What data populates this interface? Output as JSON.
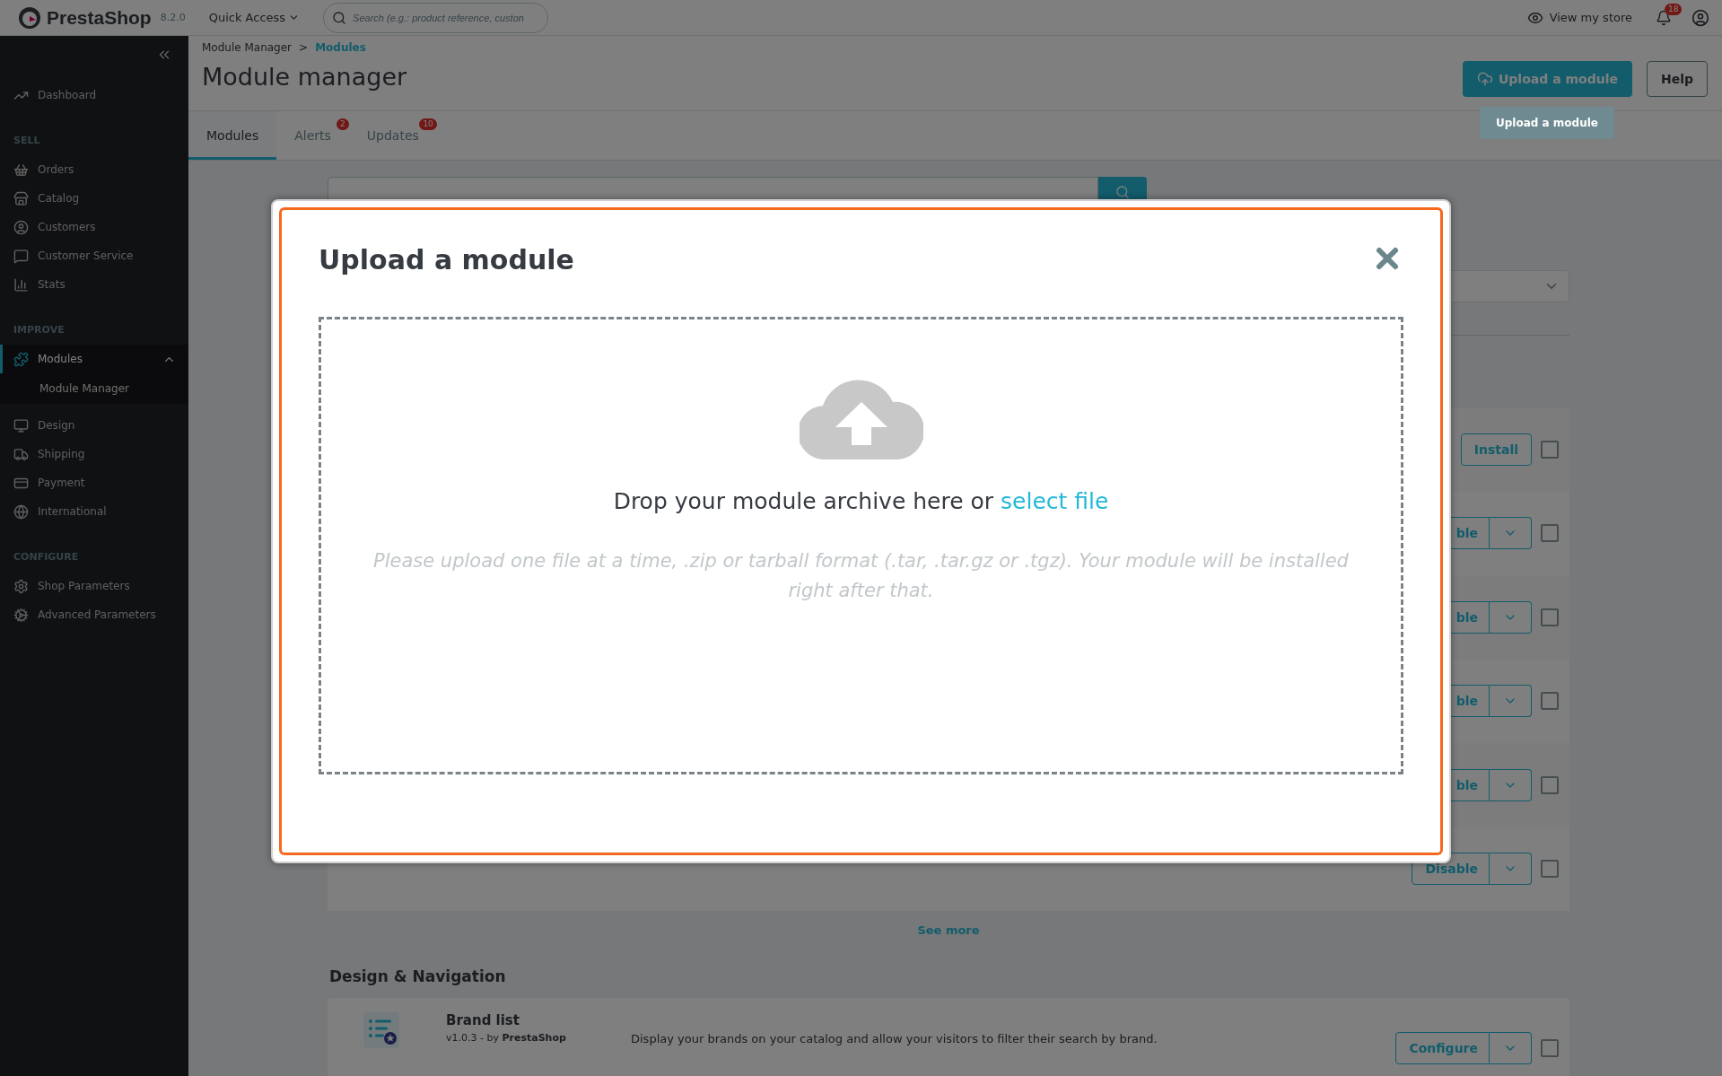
{
  "topbar": {
    "logo": "PrestaShop",
    "version": "8.2.0",
    "quick_access": "Quick Access",
    "search_placeholder": "Search (e.g.: product reference, custon",
    "view_store": "View my store",
    "notifications": "18"
  },
  "sidebar": {
    "items": [
      {
        "kind": "link",
        "label": "Dashboard",
        "selected": false
      },
      {
        "kind": "heading",
        "label": "SELL"
      },
      {
        "kind": "link",
        "label": "Orders",
        "selected": false
      },
      {
        "kind": "link",
        "label": "Catalog",
        "selected": false
      },
      {
        "kind": "link",
        "label": "Customers",
        "selected": false
      },
      {
        "kind": "link",
        "label": "Customer Service",
        "selected": false
      },
      {
        "kind": "link",
        "label": "Stats",
        "selected": false
      },
      {
        "kind": "heading",
        "label": "IMPROVE"
      },
      {
        "kind": "link",
        "label": "Modules",
        "selected": true,
        "expanded": true,
        "children": [
          {
            "label": "Module Manager",
            "selected": false
          }
        ]
      },
      {
        "kind": "link",
        "label": "Design",
        "selected": false
      },
      {
        "kind": "link",
        "label": "Shipping",
        "selected": false
      },
      {
        "kind": "link",
        "label": "Payment",
        "selected": false
      },
      {
        "kind": "link",
        "label": "International",
        "selected": false
      },
      {
        "kind": "heading",
        "label": "CONFIGURE"
      },
      {
        "kind": "link",
        "label": "Shop Parameters",
        "selected": false
      },
      {
        "kind": "link",
        "label": "Advanced Parameters",
        "selected": false
      }
    ]
  },
  "header": {
    "breadcrumb": [
      "Module Manager",
      "Modules"
    ],
    "breadcrumb_separator": ">",
    "title": "Module manager",
    "upload_button": "Upload a module",
    "help_button": "Help",
    "tooltip": "Upload a module",
    "tabs": [
      {
        "label": "Modules",
        "selected": true
      },
      {
        "label": "Alerts",
        "badge": "2",
        "selected": false
      },
      {
        "label": "Updates",
        "badge": "10",
        "selected": false
      }
    ]
  },
  "module_rows": [
    {
      "kind": "install",
      "action": "Install",
      "checked": false
    },
    {
      "kind": "split",
      "action": "ble",
      "checked": false
    },
    {
      "kind": "split",
      "action": "ble",
      "checked": false
    },
    {
      "kind": "split",
      "action": "ble",
      "checked": false
    },
    {
      "kind": "split",
      "action": "ble",
      "checked": false
    },
    {
      "kind": "split",
      "action": "Disable",
      "checked": false
    }
  ],
  "see_more": "See more",
  "section": {
    "title": "Design & Navigation",
    "module": {
      "name": "Brand list",
      "version": "v1.0.3 - by **PrestaShop**",
      "description": "Display your brands on your catalog and allow your visitors to filter their search by brand.",
      "action": "Configure",
      "checked": false
    }
  },
  "modal": {
    "title": "Upload a module",
    "drop_text": "Drop your module archive here or",
    "select_link": "select file",
    "hint": "Please upload one file at a time, .zip or tarball format (.tar, .tar.gz or .tgz). Your module will be installed right after that."
  }
}
